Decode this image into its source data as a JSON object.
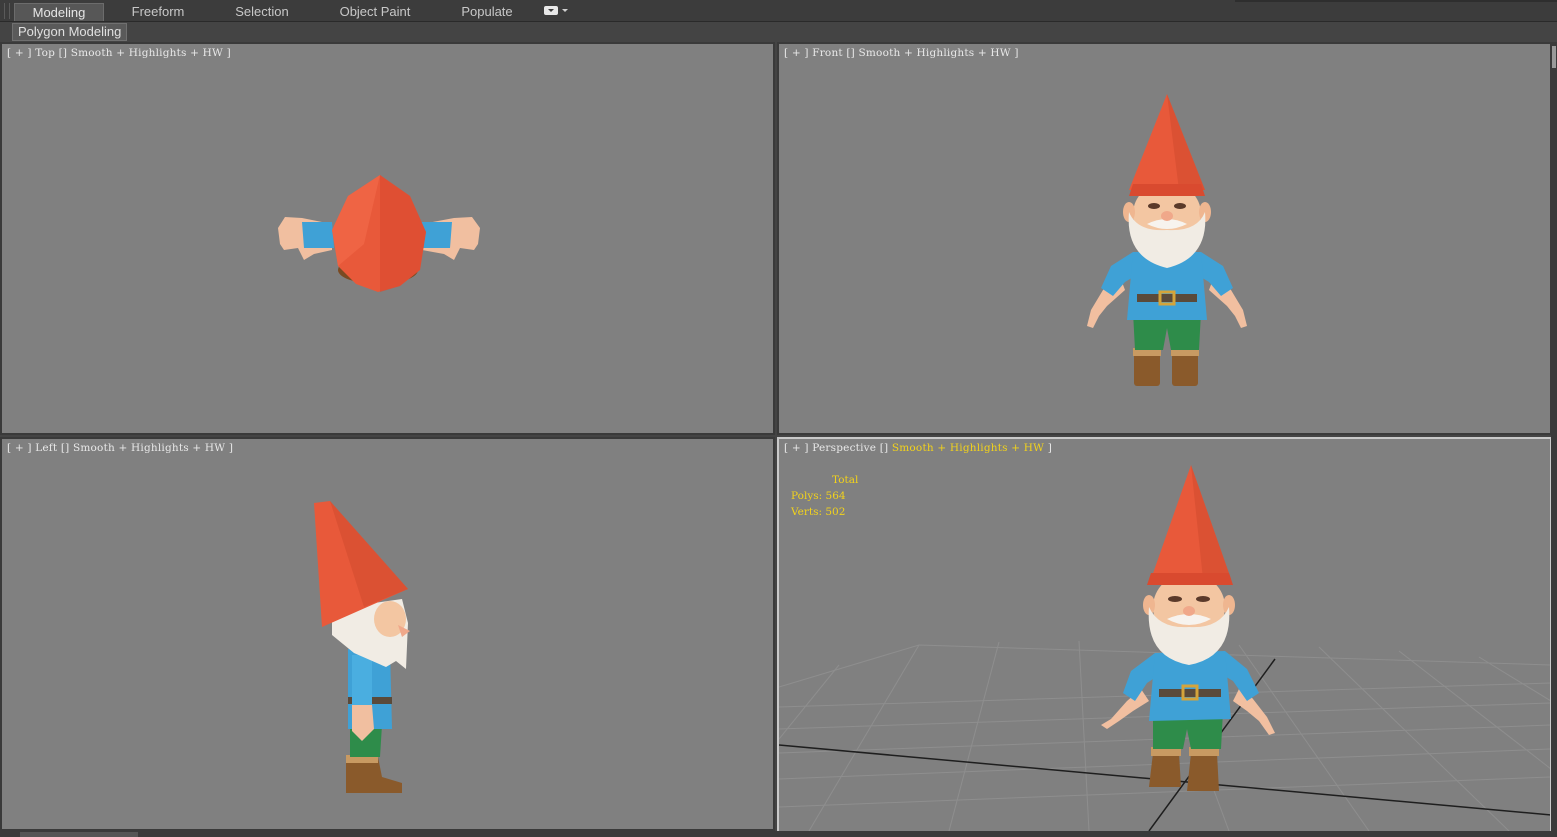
{
  "ribbon": {
    "tabs": [
      {
        "label": "Modeling",
        "active": true
      },
      {
        "label": "Freeform",
        "active": false
      },
      {
        "label": "Selection",
        "active": false
      },
      {
        "label": "Object Paint",
        "active": false
      },
      {
        "label": "Populate",
        "active": false
      }
    ],
    "options_icon": "ribbon-options-dropdown-icon"
  },
  "panel": {
    "label": "Polygon Modeling"
  },
  "viewports": {
    "top": {
      "plus": "[ + ]",
      "name": "Top",
      "shading": "Smooth + Highlights + HW",
      "close": "]"
    },
    "front": {
      "plus": "[ + ]",
      "name": "Front",
      "shading": "Smooth + Highlights + HW",
      "close": "]"
    },
    "left": {
      "plus": "[ + ]",
      "name": "Left",
      "shading": "Smooth + Highlights + HW",
      "close": "]"
    },
    "perspective": {
      "plus": "[ + ]",
      "name": "Perspective",
      "shading": "Smooth + Highlights + HW",
      "close": "]"
    }
  },
  "stats": {
    "total_label": "Total",
    "polys_label": "Polys:",
    "polys_value": "564",
    "verts_label": "Verts:",
    "verts_value": "502"
  },
  "colors": {
    "viewport_bg": "#808080",
    "highlight_text": "#f2d21b",
    "hat": "#e8593a",
    "shirt": "#3fa1d6",
    "pants": "#2e8c4a",
    "boots": "#8a5a2b",
    "skin": "#f3c6a2",
    "beard": "#f1ece4"
  }
}
